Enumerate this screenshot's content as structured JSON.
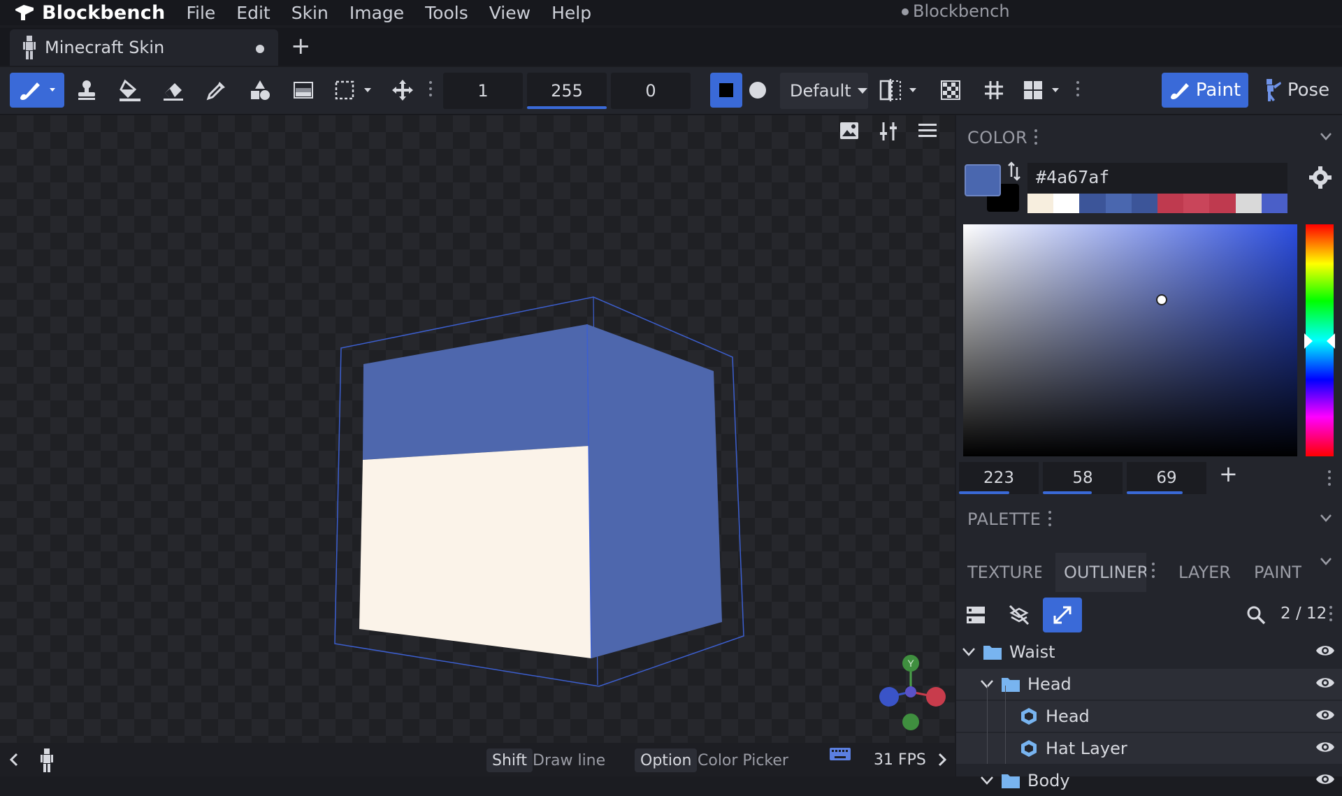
{
  "app": {
    "name": "Blockbench",
    "window_title": "Blockbench"
  },
  "menu": [
    "File",
    "Edit",
    "Skin",
    "Image",
    "Tools",
    "View",
    "Help"
  ],
  "tab": {
    "label": "Minecraft Skin",
    "add": "+"
  },
  "toolbar": {
    "size": "1",
    "opacity": "255",
    "softness": "0",
    "blend_mode": "Default",
    "paint_label": "Paint",
    "pose_label": "Pose"
  },
  "color_panel": {
    "title": "COLOR",
    "hex": "#4a67af",
    "primary": "#4a67af",
    "secondary": "#000000",
    "palette_strip": [
      "#f7eede",
      "#ffffff",
      "#3c5599",
      "#4a67af",
      "#3c5599",
      "#bf3a4f",
      "#c9455a",
      "#bf3a4f",
      "#d9d9d9",
      "#4a5fc8"
    ],
    "rgb": [
      "223",
      "58",
      "69"
    ],
    "add": "+"
  },
  "palette_panel": {
    "title": "PALETTE"
  },
  "panel_tabs": [
    "TEXTURES",
    "OUTLINER",
    "LAYERS",
    "PAINT"
  ],
  "outliner": {
    "counter": "2 / 12",
    "items": [
      {
        "label": "Waist",
        "type": "folder",
        "depth": 0
      },
      {
        "label": "Head",
        "type": "folder",
        "depth": 1
      },
      {
        "label": "Head",
        "type": "cube",
        "depth": 2
      },
      {
        "label": "Hat Layer",
        "type": "cube",
        "depth": 2
      },
      {
        "label": "Body",
        "type": "folder",
        "depth": 1
      }
    ]
  },
  "statusbar": {
    "key1": "Shift",
    "desc1": "Draw line",
    "key2": "Option",
    "desc2": "Color Picker",
    "fps": "31 FPS"
  },
  "gizmo": {
    "y_label": "Y"
  }
}
